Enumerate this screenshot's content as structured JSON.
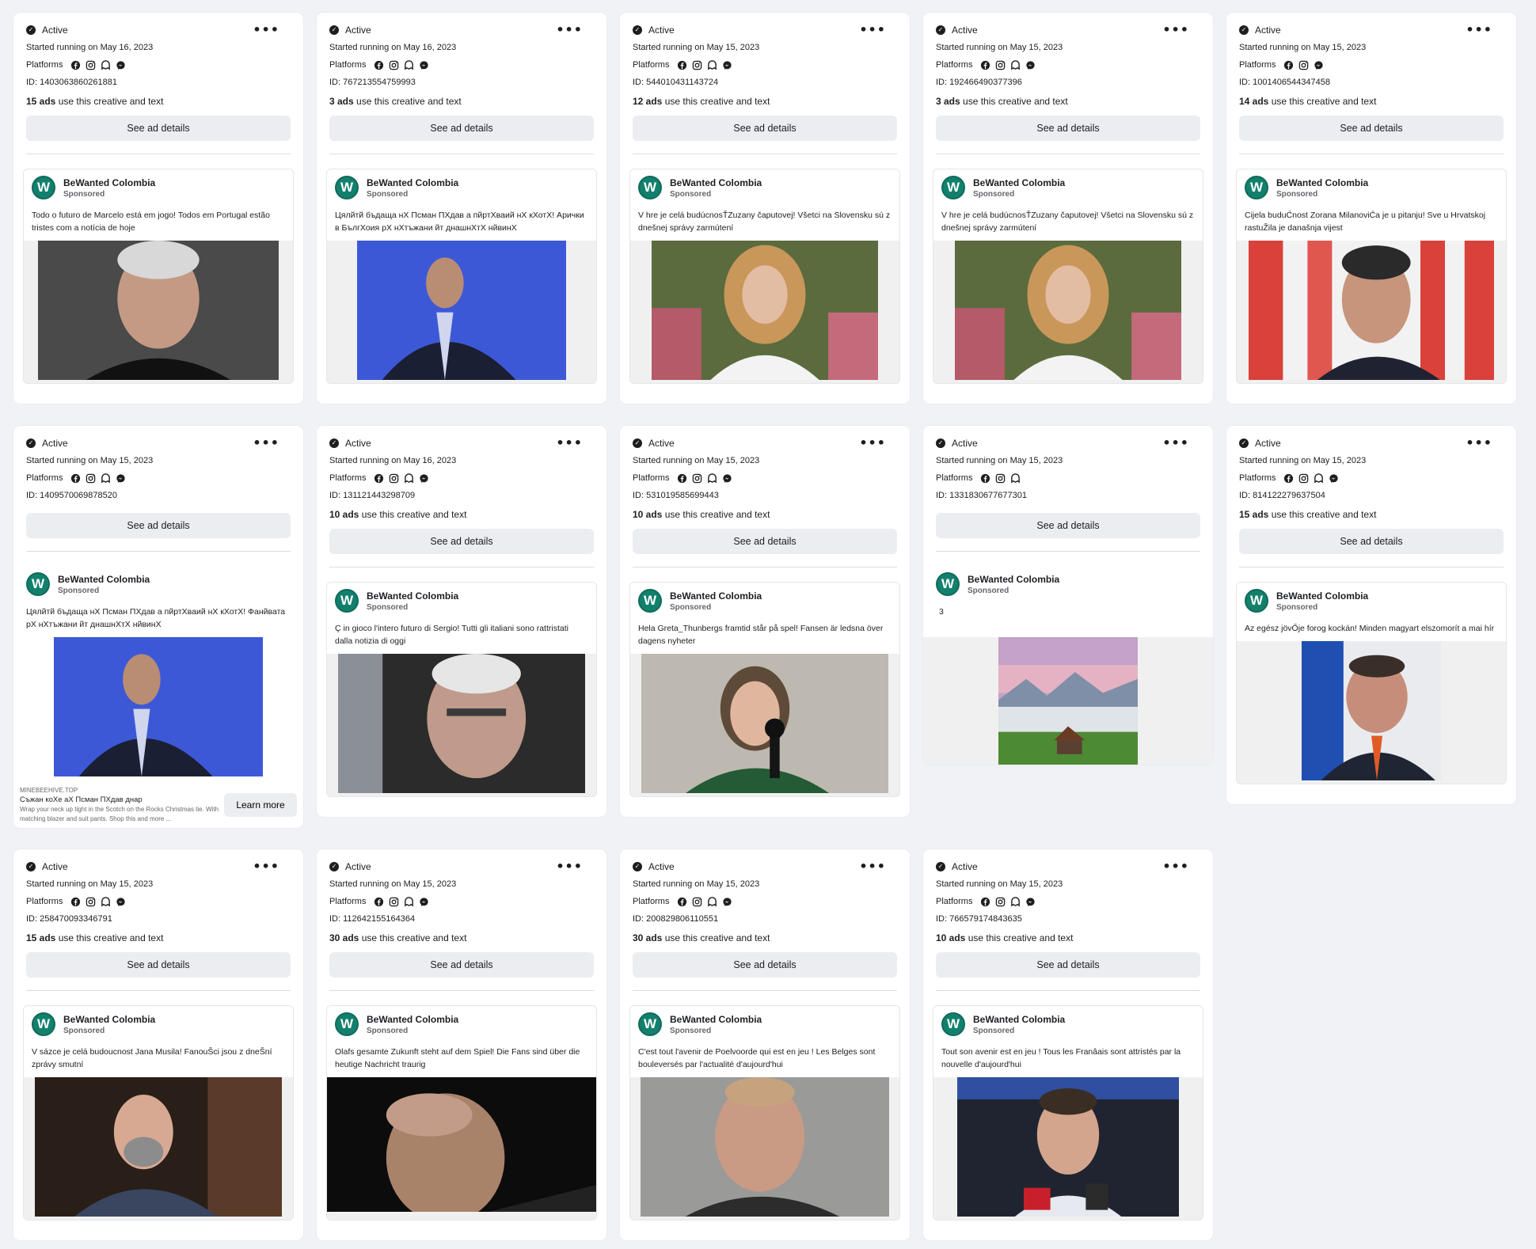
{
  "labels": {
    "platforms": "Platforms",
    "see_details": "See ad details",
    "use_suffix": " use this creative and text",
    "sponsored": "Sponsored",
    "advertiser": "BeWanted Colombia",
    "learn_more": "Learn more"
  },
  "colors": {
    "logo": "#12806d",
    "background": "#f0f2f5"
  },
  "platform_icons": [
    "facebook-icon",
    "instagram-icon",
    "audience-network-icon",
    "messenger-icon"
  ],
  "cards": [
    {
      "status": "Active",
      "started": "Started running on May 16, 2023",
      "id": "ID: 1403063860261881",
      "ads": "15 ads",
      "text": "Todo o futuro de Marcelo está em jogo! Todos em Portugal estão tristes com a notícia de hoje",
      "image": "man-portrait-photo"
    },
    {
      "status": "Active",
      "started": "Started running on May 16, 2023",
      "id": "ID: 767213554759993",
      "ads": "3 ads",
      "text": "Цялйтй бъдаща нХ Псман ПХдав а пйртХваий нХ кХотХ! Арички в БългХоия рХ нХтъжани йт днашнХтХ нйвинХ",
      "image": "man-suit-photo"
    },
    {
      "status": "Active",
      "started": "Started running on May 15, 2023",
      "id": "ID: 544010431143724",
      "ads": "12 ads",
      "text": "V hre je celá budúcnosŤZuzany čaputovej! Všetci na Slovensku sú z dnešnej správy zarmútení",
      "image": "woman-portrait-photo"
    },
    {
      "status": "Active",
      "started": "Started running on May 15, 2023",
      "id": "ID: 192466490377396",
      "ads": "3 ads",
      "text": "V hre je celá budúcnosŤZuzany čaputovej! Všetci na Slovensku sú z dnešnej správy zarmútení",
      "image": "woman-portrait-photo"
    },
    {
      "status": "Active",
      "started": "Started running on May 15, 2023",
      "id": "ID: 1001406544347458",
      "ads": "14 ads",
      "text": "Cijela buduĆnost Zorana MilanoviĆa je u pitanju! Sve u Hrvatskoj rastuŽila je današnja vijest",
      "image": "man-flags-photo"
    },
    {
      "status": "Active",
      "started": "Started running on May 15, 2023",
      "id": "ID: 1409570069878520",
      "ads": "",
      "text": "Цялйтй бъдаща нХ Псман ПХдав а пйртХваий нХ кХотХ! Фанйвата рХ нХтъжани йт днашнХтХ нйвинХ",
      "image": "man-suit-photo",
      "link": {
        "domain": "MINEBEEHIVE.TOP",
        "title": "Съжан коХе аХ Псман ПХдав днар",
        "desc": "Wrap your neck up tight in the Scotch on the Rocks Christmas tie. With matching blazer and suit pants. Shop this and more ..."
      }
    },
    {
      "status": "Active",
      "started": "Started running on May 16, 2023",
      "id": "ID: 131121443298709",
      "ads": "10 ads",
      "text": "Ç in gioco l'intero futuro di Sergio! Tutti gli italiani sono rattristati dalla notizia di oggi",
      "image": "older-man-photo"
    },
    {
      "status": "Active",
      "started": "Started running on May 15, 2023",
      "id": "ID: 531019585699443",
      "ads": "10 ads",
      "text": "Hela Greta_Thunbergs framtid står på spel! Fansen är ledsna över dagens nyheter",
      "image": "girl-microphone-photo"
    },
    {
      "status": "Active",
      "started": "Started running on May 15, 2023",
      "id": "ID: 1331830677677301",
      "ads": "",
      "text": "3",
      "image": "landscape-hut-photo"
    },
    {
      "status": "Active",
      "started": "Started running on May 15, 2023",
      "id": "ID: 814122279637504",
      "ads": "15 ads",
      "text": "Az egész jövŐje forog kockán! Minden magyart elszomorít a mai hír",
      "image": "man-speaking-photo"
    },
    {
      "status": "Active",
      "started": "Started running on May 15, 2023",
      "id": "ID: 258470093346791",
      "ads": "15 ads",
      "text": "V sázce je celá budoucnost Jana Musila! FanouŠci jsou z dneŠní zprávy smutní",
      "image": "bald-man-photo"
    },
    {
      "status": "Active",
      "started": "Started running on May 15, 2023",
      "id": "ID: 112642155164364",
      "ads": "30 ads",
      "text": "Olafs gesamte Zukunft steht auf dem Spiel! Die Fans sind über die heutige Nachricht traurig",
      "image": "bald-man-dark-photo"
    },
    {
      "status": "Active",
      "started": "Started running on May 15, 2023",
      "id": "ID: 200829806110551",
      "ads": "30 ads",
      "text": "C'est tout l'avenir de Poelvoorde qui est en jeu ! Les Belges sont bouleversés par l'actualité d'aujourd'hui",
      "image": "man-close-photo"
    },
    {
      "status": "Active",
      "started": "Started running on May 15, 2023",
      "id": "ID: 766579174843635",
      "ads": "10 ads",
      "text": "Tout son avenir est en jeu ! Tous les Franâais sont attristés par la nouvelle d'aujourd'hui",
      "image": "man-press-photo"
    }
  ]
}
